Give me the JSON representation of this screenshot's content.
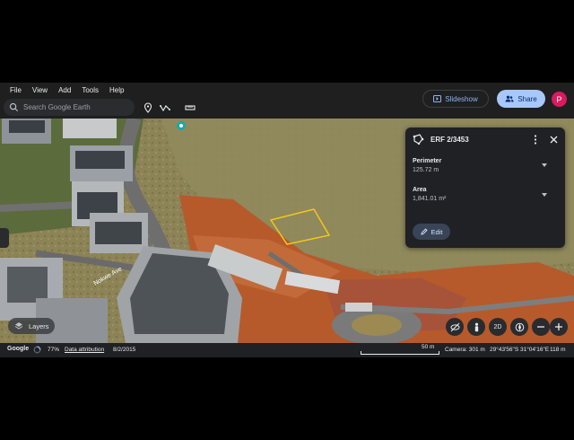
{
  "menu": [
    "File",
    "View",
    "Add",
    "Tools",
    "Help"
  ],
  "search": {
    "placeholder": "Search Google Earth"
  },
  "header": {
    "slideshow_label": "Slideshow",
    "share_label": "Share",
    "avatar_letter": "P"
  },
  "panel": {
    "title": "ERF 2/3453",
    "perimeter_label": "Perimeter",
    "perimeter_value": "125.72 m",
    "area_label": "Area",
    "area_value": "1,841.01 m²",
    "edit_label": "Edit"
  },
  "map": {
    "street_label": "Nokwe Ave",
    "layers_label": "Layers",
    "view_2d_label": "2D",
    "polygon_color": "#f5c518"
  },
  "status": {
    "logo": "Google",
    "load_percent": "77%",
    "attribution": "Data attribution",
    "date": "8/2/2015",
    "scale": "50 m",
    "camera": "Camera: 301 m",
    "coords": "29°43'56\"S 31°04'16\"E",
    "elevation": "118 m"
  },
  "colors": {
    "accent": "#8ab4f8",
    "share_bg": "#a8c7fa",
    "avatar": "#d81b60"
  }
}
